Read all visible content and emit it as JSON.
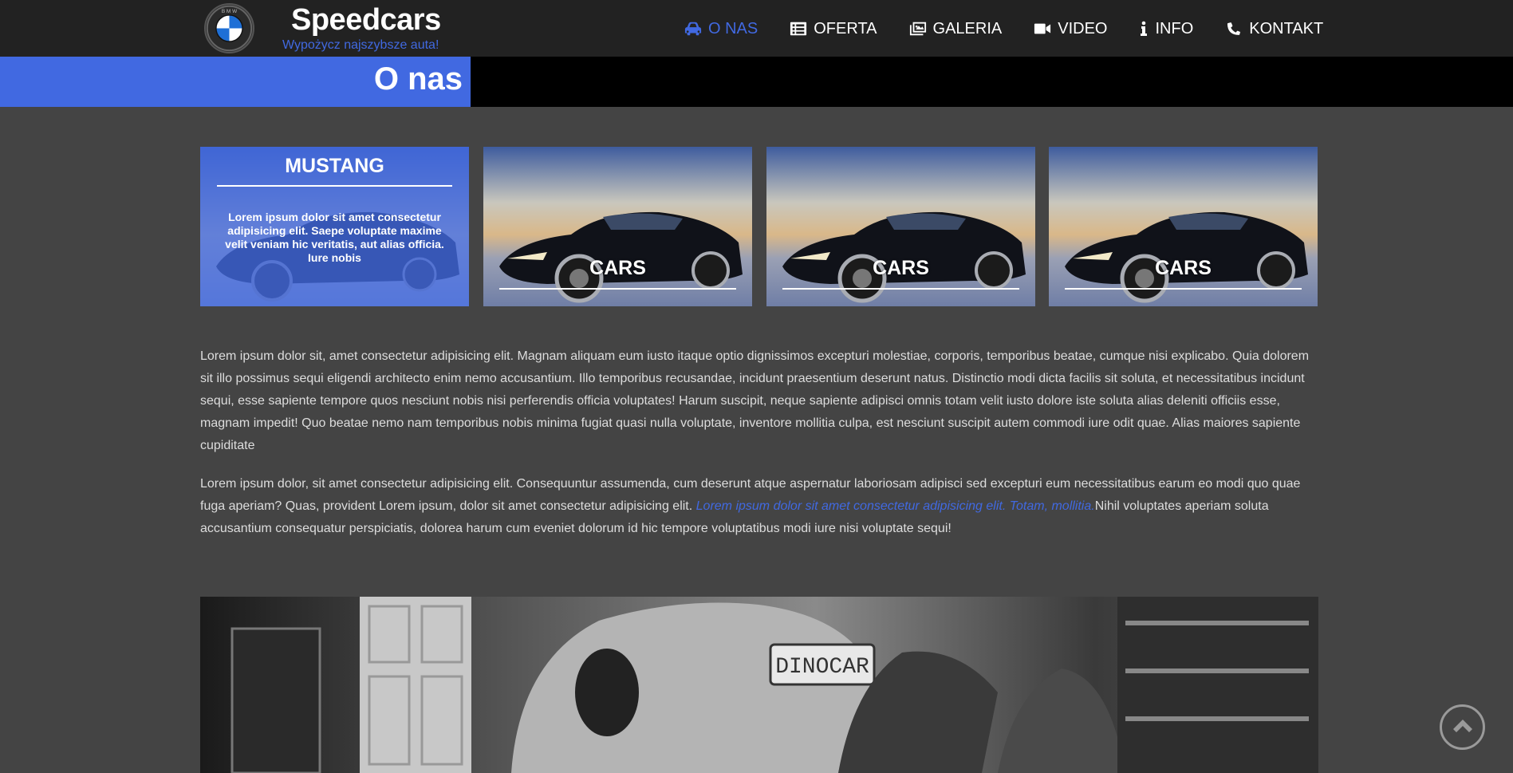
{
  "brand": {
    "title": "Speedcars",
    "subtitle": "Wypożycz najszybsze auta!",
    "logo_icon": "bmw-logo-icon"
  },
  "nav": {
    "items": [
      {
        "label": "O NAS",
        "icon": "car-icon",
        "active": true
      },
      {
        "label": "OFERTA",
        "icon": "list-icon",
        "active": false
      },
      {
        "label": "GALERIA",
        "icon": "images-icon",
        "active": false
      },
      {
        "label": "VIDEO",
        "icon": "video-camera-icon",
        "active": false
      },
      {
        "label": "INFO",
        "icon": "info-icon",
        "active": false
      },
      {
        "label": "KONTAKT",
        "icon": "phone-icon",
        "active": false
      }
    ]
  },
  "page_header": {
    "title": "O nas"
  },
  "cards": {
    "featured": {
      "title": "MUSTANG",
      "text": "Lorem ipsum dolor sit amet consectetur adipisicing elit. Saepe voluptate maxime velit veniam hic veritatis, aut alias officia. Iure nobis"
    },
    "items": [
      {
        "label": "CARS"
      },
      {
        "label": "CARS"
      },
      {
        "label": "CARS"
      }
    ]
  },
  "content": {
    "paragraph1": "Lorem ipsum dolor sit, amet consectetur adipisicing elit. Magnam aliquam eum iusto itaque optio dignissimos excepturi molestiae, corporis, temporibus beatae, cumque nisi explicabo. Quia dolorem sit illo possimus sequi eligendi architecto enim nemo accusantium. Illo temporibus recusandae, incidunt praesentium deserunt natus. Distinctio modi dicta facilis sit soluta, et necessitatibus incidunt sequi, esse sapiente tempore quos nesciunt nobis nisi perferendis officia voluptates! Harum suscipit, neque sapiente adipisci omnis totam velit iusto dolore iste soluta alias deleniti officiis esse, magnam impedit! Quo beatae nemo nam temporibus nobis minima fugiat quasi nulla voluptate, inventore mollitia culpa, est nesciunt suscipit autem commodi iure odit quae. Alias maiores sapiente cupiditate",
    "paragraph2_start": "Lorem ipsum dolor, sit amet consectetur adipisicing elit. Consequuntur assumenda, cum deserunt atque aspernatur laboriosam adipisci sed excepturi eum necessitatibus earum eo modi quo quae fuga aperiam? Quas, provident Lorem ipsum, dolor sit amet consectetur adipisicing elit. ",
    "paragraph2_emphasis": "Lorem ipsum dolor sit amet consectetur adipisicing elit. Totam, mollitia.",
    "paragraph2_end": "Nihil voluptates aperiam soluta accusantium consequatur perspiciatis, dolorea harum cum eveniet dolorum id hic tempore voluptatibus modi iure nisi voluptate sequi!"
  },
  "photo": {
    "plate_text": "DINOCAR"
  },
  "scroll_top": {
    "icon": "chevron-up-circle-icon"
  },
  "colors": {
    "accent": "#4169e1",
    "navbar_bg": "#222222",
    "page_bg": "#444444",
    "band_bg": "#000000"
  }
}
